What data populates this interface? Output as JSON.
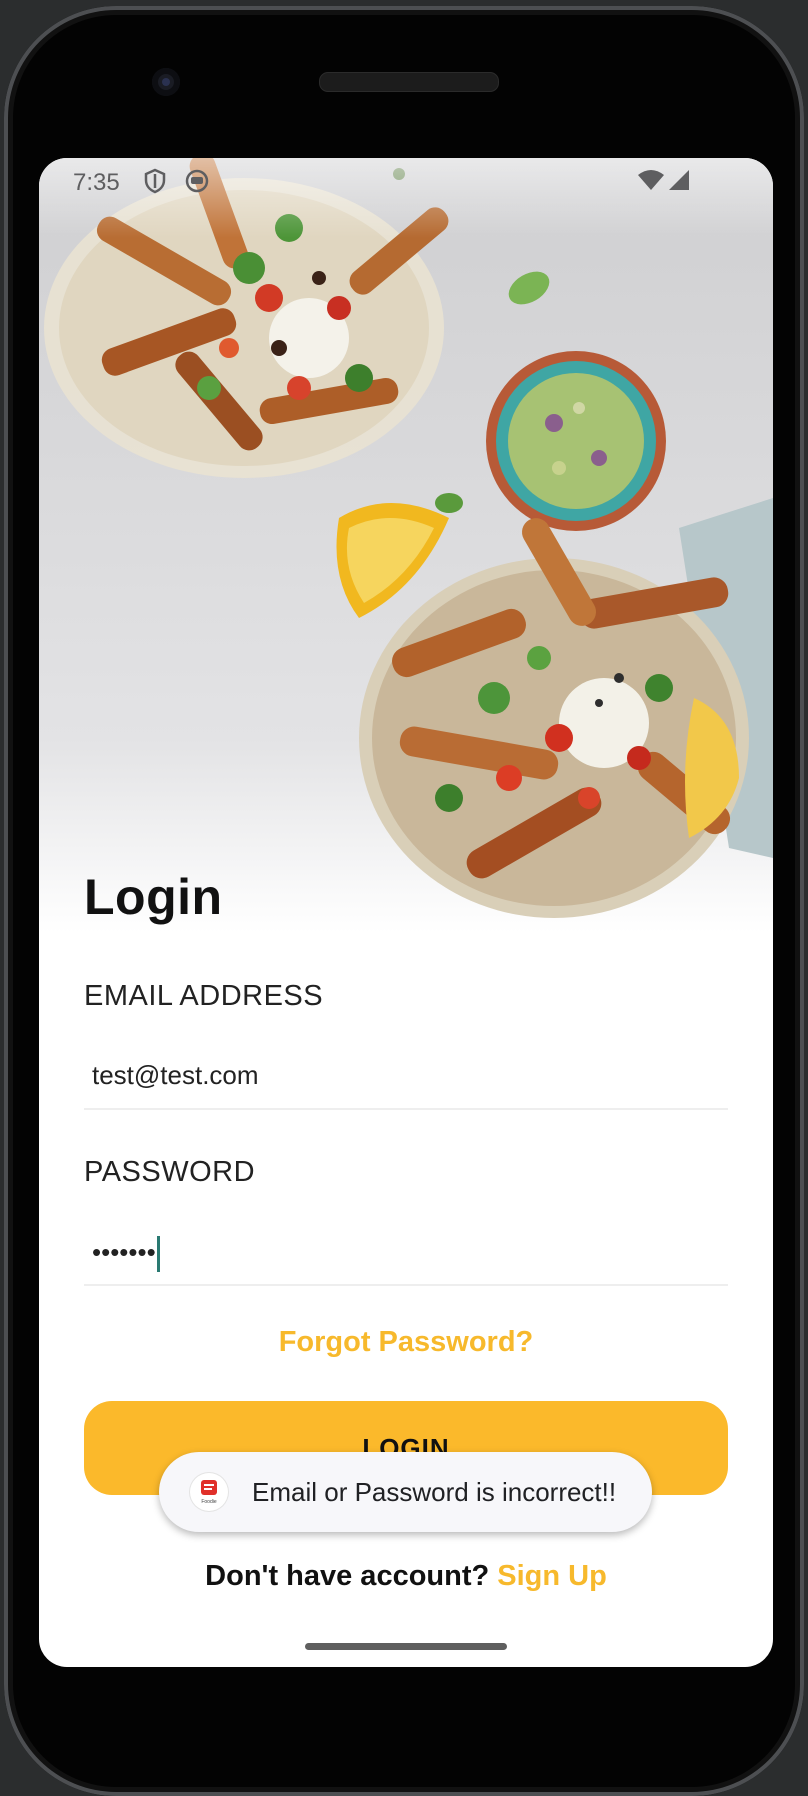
{
  "status_bar": {
    "time": "7:35",
    "icons": [
      "shield-icon",
      "face-mask-icon",
      "wifi-icon",
      "cell-signal-icon"
    ]
  },
  "hero": {
    "image": "food-bowls-photo"
  },
  "login": {
    "title": "Login",
    "email_label": "EMAIL ADDRESS",
    "email_value": "test@test.com",
    "password_label": "PASSWORD",
    "password_value": "•••••••",
    "forgot_password": "Forgot Password?",
    "login_button": "LOGIN",
    "no_account_text": "Don't have account?",
    "signup_link": "Sign Up"
  },
  "toast": {
    "message": "Email or Password is incorrect!!",
    "app_icon_label": "Foodie"
  },
  "colors": {
    "accent": "#fbb92b",
    "link": "#f7b92c",
    "caret": "#2a7a72"
  }
}
